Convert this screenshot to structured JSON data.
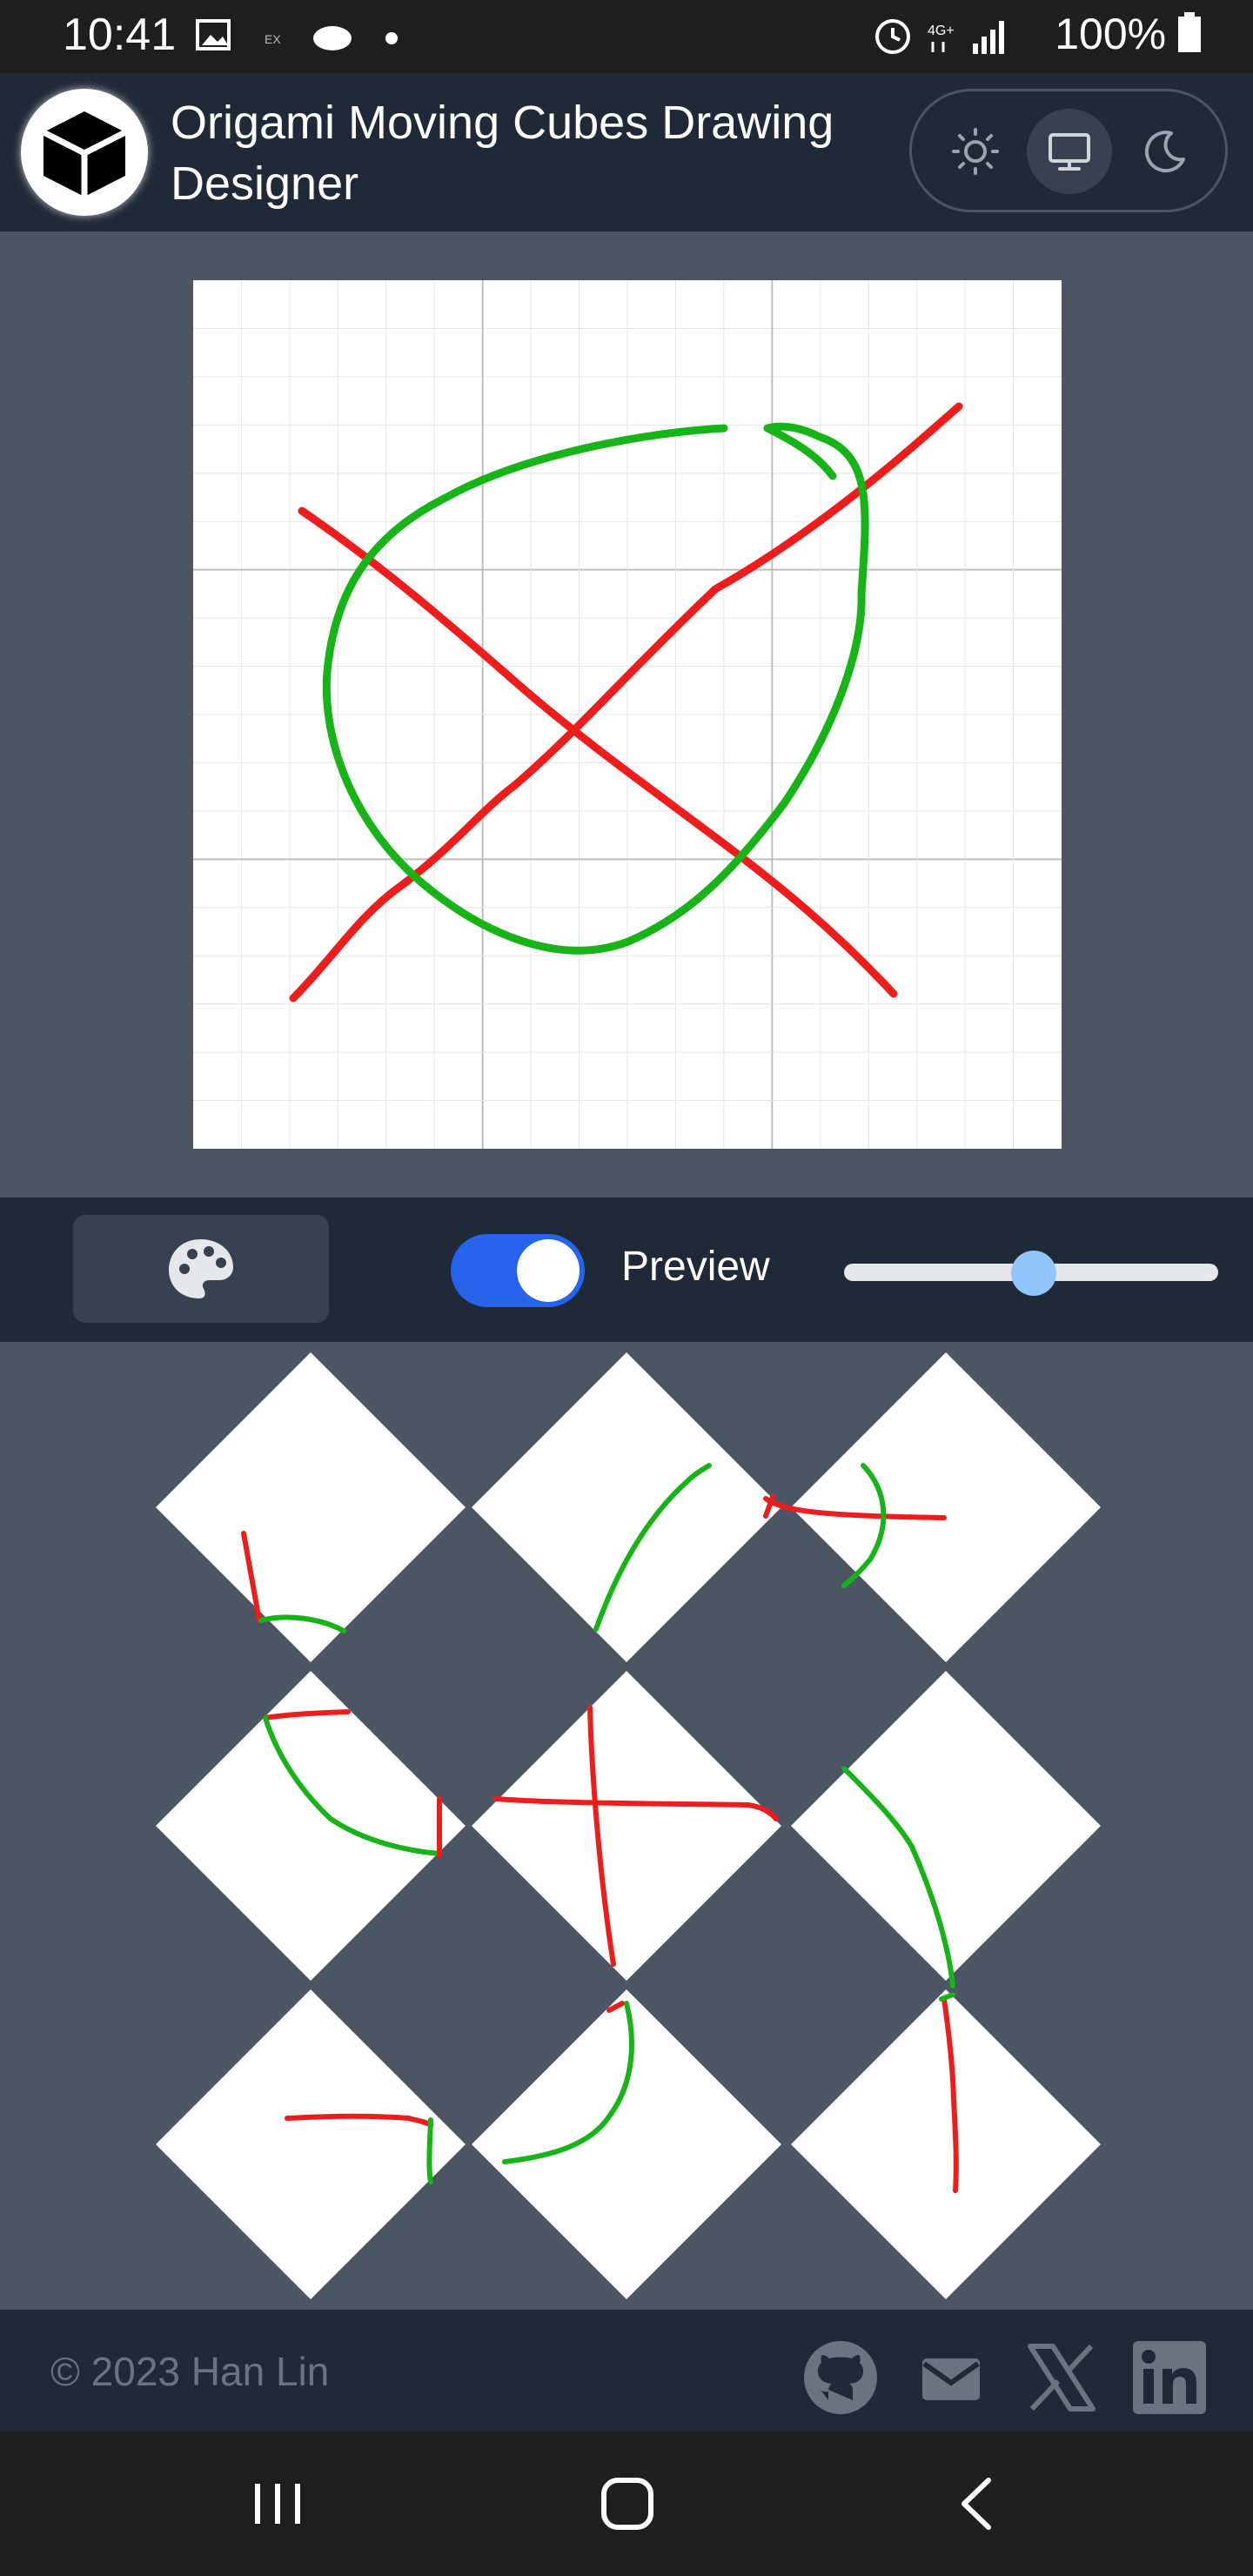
{
  "status_bar": {
    "time": "10:41",
    "battery": "100%",
    "network": "4G+"
  },
  "header": {
    "title": "Origami Moving Cubes Drawing Designer",
    "logo_icon": "cube-icon",
    "theme_options": [
      "sun-icon",
      "monitor-icon",
      "moon-icon"
    ],
    "theme_selected": "monitor-icon"
  },
  "toolbar": {
    "palette_icon": "palette-icon",
    "preview_label": "Preview",
    "preview_enabled": true,
    "slider_value": 0.5
  },
  "footer": {
    "copyright": "© 2023  Han Lin",
    "social_icons": [
      "github-icon",
      "mail-icon",
      "x-icon",
      "linkedin-icon"
    ]
  },
  "colors": {
    "stroke_red": "#ef1c1c",
    "stroke_green": "#16b416",
    "background": "#4b5563",
    "header": "#1f2937",
    "accent": "#2563eb"
  }
}
